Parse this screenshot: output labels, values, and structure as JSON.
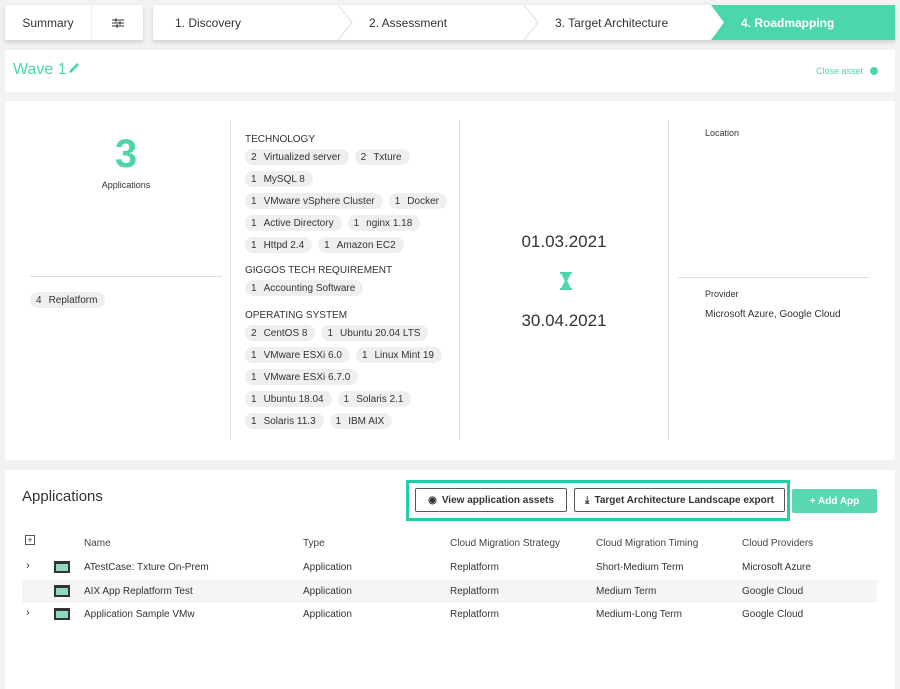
{
  "nav": {
    "summary": "Summary",
    "settings_icon": "sliders-icon",
    "steps": [
      {
        "label": "1. Discovery"
      },
      {
        "label": "2. Assessment"
      },
      {
        "label": "3. Target Architecture"
      },
      {
        "label": "4. Roadmapping",
        "active": true
      }
    ]
  },
  "header": {
    "title": "Wave 1",
    "close": "Close asset"
  },
  "colors": {
    "accent": "#4cd6ac",
    "highlight": "#1ecfa8"
  },
  "stats": {
    "count": "3",
    "count_label": "Applications",
    "strategies": [
      {
        "n": "4",
        "label": "Replatform"
      }
    ],
    "technology_title": "TECHNOLOGY",
    "technology": [
      {
        "n": "2",
        "label": "Virtualized server"
      },
      {
        "n": "2",
        "label": "Txture"
      },
      {
        "n": "1",
        "label": "MySQL 8"
      },
      {
        "n": "1",
        "label": "VMware vSphere Cluster"
      },
      {
        "n": "1",
        "label": "Docker"
      },
      {
        "n": "1",
        "label": "Active Directory"
      },
      {
        "n": "1",
        "label": "nginx 1.18"
      },
      {
        "n": "1",
        "label": "Httpd 2.4"
      },
      {
        "n": "1",
        "label": "Amazon EC2"
      }
    ],
    "req_title": "GIGGOS TECH REQUIREMENT",
    "req": [
      {
        "n": "1",
        "label": "Accounting Software"
      }
    ],
    "os_title": "OPERATING SYSTEM",
    "os": [
      {
        "n": "2",
        "label": "CentOS 8"
      },
      {
        "n": "1",
        "label": "Ubuntu 20.04 LTS"
      },
      {
        "n": "1",
        "label": "VMware ESXi 6.0"
      },
      {
        "n": "1",
        "label": "Linux Mint 19"
      },
      {
        "n": "1",
        "label": "VMware ESXi 6.7.0"
      },
      {
        "n": "1",
        "label": "Ubuntu 18.04"
      },
      {
        "n": "1",
        "label": "Solaris 2.1"
      },
      {
        "n": "1",
        "label": "Solaris 11.3"
      },
      {
        "n": "1",
        "label": "IBM AIX"
      }
    ],
    "start": "01.03.2021",
    "end": "30.04.2021",
    "location_label": "Location",
    "provider_label": "Provider",
    "provider": "Microsoft Azure, Google Cloud"
  },
  "apps": {
    "title": "Applications",
    "view_btn": "View application assets",
    "export_btn": "Target Architecture Landscape export",
    "add_btn": "+ Add App",
    "columns": [
      "Name",
      "Type",
      "Cloud Migration Strategy",
      "Cloud Migration Timing",
      "Cloud Providers"
    ],
    "rows": [
      {
        "expandable": true,
        "cells": [
          "ATestCase: Txture On-Prem",
          "Application",
          "Replatform",
          "Short-Medium Term",
          "Microsoft Azure"
        ]
      },
      {
        "expandable": false,
        "cells": [
          "AIX App Replatform Test",
          "Application",
          "Replatform",
          "Medium Term",
          "Google Cloud"
        ]
      },
      {
        "expandable": true,
        "cells": [
          "Application Sample VMw",
          "Application",
          "Replatform",
          "Medium-Long Term",
          "Google Cloud"
        ]
      }
    ]
  }
}
